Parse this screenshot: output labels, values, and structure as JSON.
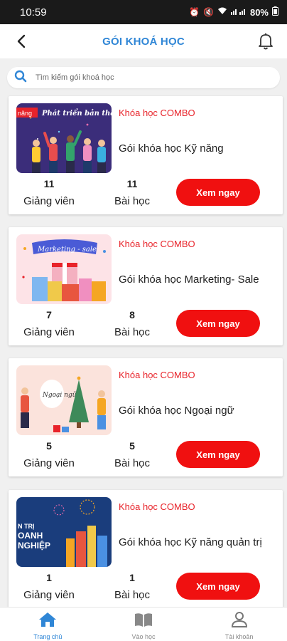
{
  "status": {
    "time": "10:59",
    "battery": "80%"
  },
  "header": {
    "title": "GÓI KHOÁ HỌC"
  },
  "search": {
    "placeholder": "Tìm kiếm gói khoá học"
  },
  "cards": [
    {
      "tag": "Khóa học COMBO",
      "name": "Gói khóa học Kỹ năng",
      "instructors": "11",
      "lessons": "11",
      "instructors_label": "Giảng viên",
      "lessons_label": "Bài học",
      "button": "Xem ngay",
      "thumb_text": "Phát triển bản thân",
      "thumb_badge": "năng"
    },
    {
      "tag": "Khóa học COMBO",
      "name": "Gói khóa học Marketing- Sale",
      "instructors": "7",
      "lessons": "8",
      "instructors_label": "Giảng viên",
      "lessons_label": "Bài học",
      "button": "Xem ngay",
      "thumb_text": "Marketing - sale"
    },
    {
      "tag": "Khóa học COMBO",
      "name": "Gói khóa học Ngoại ngữ",
      "instructors": "5",
      "lessons": "5",
      "instructors_label": "Giảng viên",
      "lessons_label": "Bài học",
      "button": "Xem ngay",
      "thumb_text": "Ngoại ngữ"
    },
    {
      "tag": "Khóa học COMBO",
      "name": "Gói khóa học Kỹ năng quản trị",
      "instructors": "1",
      "lessons": "1",
      "instructors_label": "Giảng viên",
      "lessons_label": "Bài học",
      "button": "Xem ngay",
      "thumb_text1": "N TRỊ",
      "thumb_text2": "OANH",
      "thumb_text3": "NGHIỆP"
    }
  ],
  "nav": [
    {
      "label": "Trang chủ",
      "icon": "home-icon",
      "active": true
    },
    {
      "label": "Vào học",
      "icon": "book-icon"
    },
    {
      "label": "Tài khoản",
      "icon": "user-icon"
    }
  ],
  "colors": {
    "accent": "#2f86d6",
    "cta": "#f01010",
    "tag": "#e8232a"
  }
}
